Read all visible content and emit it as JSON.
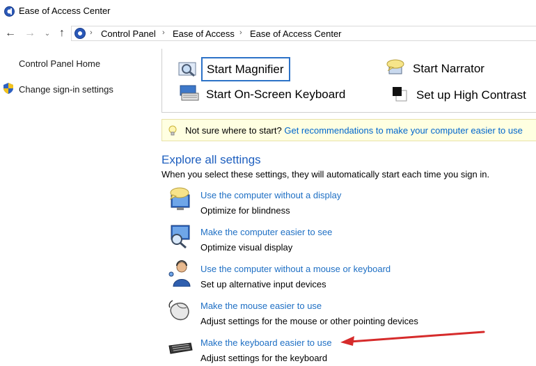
{
  "window": {
    "title": "Ease of Access Center"
  },
  "address_bar": {
    "breadcrumbs": [
      "Control Panel",
      "Ease of Access",
      "Ease of Access Center"
    ]
  },
  "left_pane": {
    "links": [
      "Control Panel Home",
      "Change sign-in settings"
    ]
  },
  "quick_access": {
    "items": [
      "Start Magnifier",
      "Start Narrator",
      "Start On-Screen Keyboard",
      "Set up High Contrast"
    ]
  },
  "tip": {
    "question": "Not sure where to start?",
    "link": "Get recommendations to make your computer easier to use"
  },
  "explore": {
    "title": "Explore all settings",
    "description": "When you select these settings, they will automatically start each time you sign in.",
    "settings": [
      {
        "link": "Use the computer without a display",
        "description": "Optimize for blindness",
        "icon": "monitor-speech-icon"
      },
      {
        "link": "Make the computer easier to see",
        "description": "Optimize visual display",
        "icon": "monitor-magnifier-icon"
      },
      {
        "link": "Use the computer without a mouse or keyboard",
        "description": "Set up alternative input devices",
        "icon": "person-headset-icon"
      },
      {
        "link": "Make the mouse easier to use",
        "description": "Adjust settings for the mouse or other pointing devices",
        "icon": "mouse-icon"
      },
      {
        "link": "Make the keyboard easier to use",
        "description": "Adjust settings for the keyboard",
        "icon": "keyboard-icon"
      }
    ]
  },
  "colors": {
    "link": "#1e6fc4",
    "section_title": "#1e5fbf",
    "tip_background": "#ffffe1",
    "focus_border": "#2c72c7",
    "annotation_arrow": "#d62b2b"
  }
}
